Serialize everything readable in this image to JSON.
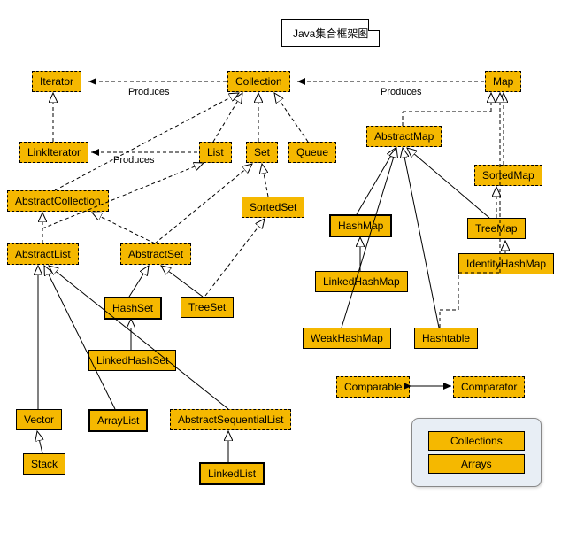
{
  "title": "Java集合框架图",
  "edge_labels": {
    "p1": "Produces",
    "p2": "Produces",
    "p3": "Produces"
  },
  "nodes": {
    "iterator": "Iterator",
    "collection": "Collection",
    "map": "Map",
    "linkiterator": "LinkIterator",
    "list": "List",
    "set": "Set",
    "queue": "Queue",
    "abstractmap": "AbstractMap",
    "sortedmap": "SortedMap",
    "abstractcollection": "AbstractCollection",
    "sortedset": "SortedSet",
    "hashmap": "HashMap",
    "treemap": "TreeMap",
    "identityhashmap": "IdentityHashMap",
    "abstractlist": "AbstractList",
    "abstractset": "AbstractSet",
    "linkedhashmap": "LinkedHashMap",
    "hashset": "HashSet",
    "treeset": "TreeSet",
    "linkedhashset": "LinkedHashSet",
    "weakhashmap": "WeakHashMap",
    "hashtable": "Hashtable",
    "comparable": "Comparable",
    "comparator": "Comparator",
    "vector": "Vector",
    "arraylist": "ArrayList",
    "abstractsequentiallist": "AbstractSequentialList",
    "stack": "Stack",
    "linkedlist": "LinkedList",
    "collections": "Collections",
    "arrays": "Arrays"
  }
}
